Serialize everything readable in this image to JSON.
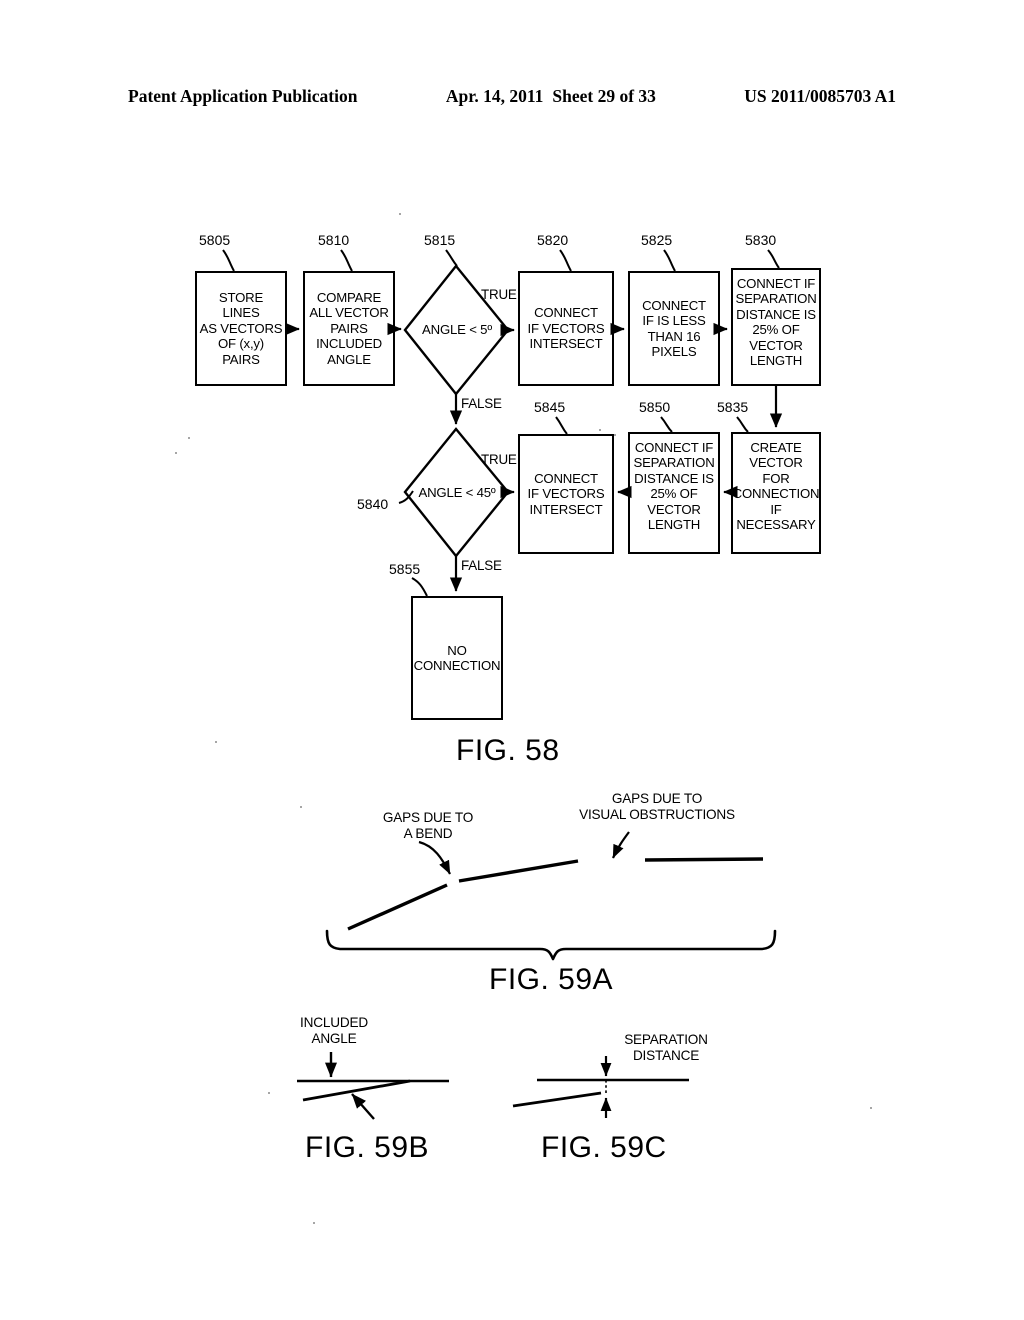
{
  "header": {
    "left": "Patent Application Publication",
    "date": "Apr. 14, 2011",
    "sheet": "Sheet 29 of 33",
    "pubnumber": "US 2011/0085703 A1"
  },
  "fig58": {
    "caption": "FIG. 58",
    "boxes": [
      {
        "id": "5805",
        "ref": "5805",
        "text": "STORE LINES\nAS VECTORS\nOF (x,y)\nPAIRS"
      },
      {
        "id": "5810",
        "ref": "5810",
        "text": "COMPARE\nALL VECTOR\nPAIRS\nINCLUDED\nANGLE"
      },
      {
        "id": "5820",
        "ref": "5820",
        "text": "CONNECT\nIF VECTORS\nINTERSECT"
      },
      {
        "id": "5825",
        "ref": "5825",
        "text": "CONNECT\nIF IS LESS\nTHAN 16\nPIXELS"
      },
      {
        "id": "5830",
        "ref": "5830",
        "text": "CONNECT IF\nSEPARATION\nDISTANCE IS\n25% OF\nVECTOR\nLENGTH"
      },
      {
        "id": "5845",
        "ref": "5845",
        "text": "CONNECT\nIF VECTORS\nINTERSECT"
      },
      {
        "id": "5850",
        "ref": "5850",
        "text": "CONNECT IF\nSEPARATION\nDISTANCE IS\n25% OF\nVECTOR\nLENGTH"
      },
      {
        "id": "5835",
        "ref": "5835",
        "text": "CREATE\nVECTOR\nFOR\nCONNECTION\nIF\nNECESSARY"
      },
      {
        "id": "5855",
        "ref": "5855",
        "text": "NO\nCONNECTION"
      }
    ],
    "decisions": [
      {
        "id": "5815",
        "ref": "5815",
        "text": "ANGLE < 5º",
        "true_label": "TRUE",
        "false_label": "FALSE"
      },
      {
        "id": "5840",
        "ref": "5840",
        "text": "ANGLE < 45º",
        "true_label": "TRUE",
        "false_label": "FALSE"
      }
    ]
  },
  "fig59a": {
    "caption": "FIG. 59A",
    "annotations": [
      {
        "id": "bend",
        "text": "GAPS DUE TO\nA BEND"
      },
      {
        "id": "obstruction",
        "text": "GAPS DUE TO\nVISUAL OBSTRUCTIONS"
      }
    ]
  },
  "fig59b": {
    "caption": "FIG. 59B",
    "annotations": [
      {
        "id": "included-angle",
        "text": "INCLUDED\nANGLE"
      }
    ]
  },
  "fig59c": {
    "caption": "FIG. 59C",
    "annotations": [
      {
        "id": "separation-distance",
        "text": "SEPARATION\nDISTANCE"
      }
    ]
  }
}
